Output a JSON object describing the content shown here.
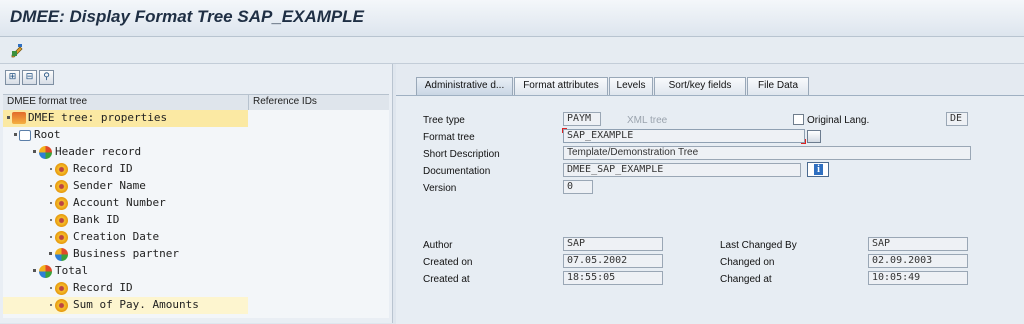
{
  "window": {
    "title": "DMEE: Display Format Tree SAP_EXAMPLE"
  },
  "toolbar": {
    "change_icon": "change-display-icon"
  },
  "tree_toolbar": {
    "buttons": [
      "expand-icon",
      "collapse-icon",
      "find-icon"
    ]
  },
  "tree": {
    "columns": [
      "DMEE format tree",
      "Reference IDs"
    ],
    "nodes": [
      {
        "label": "DMEE tree: properties",
        "icon": "dmee-tree-icon"
      },
      {
        "label": "Root",
        "icon": "root-icon"
      },
      {
        "label": "Header record",
        "icon": "segment-icon"
      },
      {
        "label": "Record ID",
        "icon": "field-icon"
      },
      {
        "label": "Sender Name",
        "icon": "field-icon"
      },
      {
        "label": "Account Number",
        "icon": "field-icon"
      },
      {
        "label": "Bank ID",
        "icon": "field-icon"
      },
      {
        "label": "Creation Date",
        "icon": "field-icon"
      },
      {
        "label": "Business partner",
        "icon": "segment-icon"
      },
      {
        "label": "Total",
        "icon": "segment-icon"
      },
      {
        "label": "Record ID",
        "icon": "field-icon"
      },
      {
        "label": "Sum of Pay. Amounts",
        "icon": "field-icon"
      }
    ]
  },
  "tabs": [
    "Administrative d...",
    "Format attributes",
    "Levels",
    "Sort/key fields",
    "File Data"
  ],
  "form": {
    "tree_type_label": "Tree type",
    "tree_type_value": "PAYM",
    "tree_type_desc": "XML tree",
    "original_lang_label": "Original Lang.",
    "original_lang_value": "DE",
    "format_tree_label": "Format tree",
    "format_tree_value": "SAP_EXAMPLE",
    "short_desc_label": "Short Description",
    "short_desc_value": "Template/Demonstration Tree",
    "documentation_label": "Documentation",
    "documentation_value": "DMEE_SAP_EXAMPLE",
    "version_label": "Version",
    "version_value": "0",
    "author_label": "Author",
    "author_value": "SAP",
    "created_on_label": "Created on",
    "created_on_value": "07.05.2002",
    "created_at_label": "Created at",
    "created_at_value": "18:55:05",
    "last_changed_by_label": "Last Changed By",
    "last_changed_by_value": "SAP",
    "changed_on_label": "Changed on",
    "changed_on_value": "02.09.2003",
    "changed_at_label": "Changed at",
    "changed_at_value": "10:05:49"
  }
}
